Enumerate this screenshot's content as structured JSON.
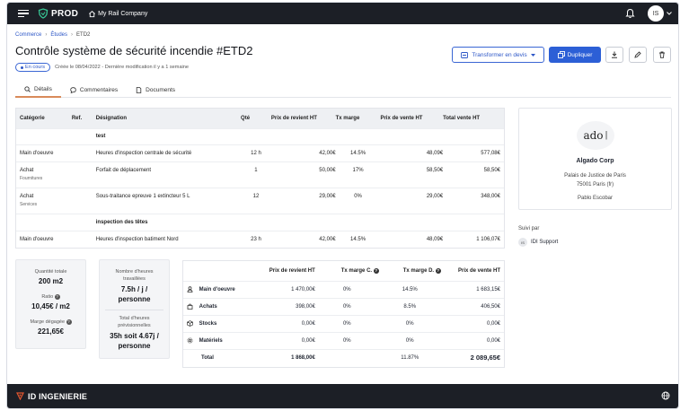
{
  "app": {
    "env": "PROD",
    "company": "My Rail Company",
    "avatar_initials": "IS"
  },
  "breadcrumb": [
    "Commerce",
    "Études",
    "ETD2"
  ],
  "page": {
    "title": "Contrôle système de sécurité incendie #ETD2",
    "status": "En cours",
    "meta": "Créée le 08/04/2022 - Dernière modification il y a 1 semaine"
  },
  "actions": {
    "transform": "Transformer en devis",
    "duplicate": "Dupliquer"
  },
  "tabs": [
    "Détails",
    "Commentaires",
    "Documents"
  ],
  "table": {
    "headers": [
      "Catégorie",
      "Ref.",
      "Désignation",
      "Qté",
      "Prix de revient HT",
      "Tx marge",
      "Prix de vente HT",
      "Total vente HT"
    ],
    "rows": [
      {
        "section": "test"
      },
      {
        "cat": "Main d'oeuvre",
        "sub": "",
        "ref": "",
        "des": "Heures d'inspection centrale de sécurité",
        "qty": "12 h",
        "cost": "42,00€",
        "margin": "14.5%",
        "price": "48,09€",
        "total": "577,08€"
      },
      {
        "cat": "Achat",
        "sub": "Fournitures",
        "ref": "",
        "des": "Forfait de déplacement",
        "qty": "1",
        "cost": "50,00€",
        "margin": "17%",
        "price": "58,50€",
        "total": "58,50€"
      },
      {
        "cat": "Achat",
        "sub": "Services",
        "ref": "",
        "des": "Sous-traitance epreuve 1 extincteur 5 L",
        "qty": "12",
        "cost": "29,00€",
        "margin": "0%",
        "price": "29,00€",
        "total": "348,00€"
      },
      {
        "section": "inspection des têtes"
      },
      {
        "cat": "Main d'oeuvre",
        "sub": "",
        "ref": "",
        "des": "Heures d'inspection batiment Nord",
        "qty": "23 h",
        "cost": "42,00€",
        "margin": "14.5%",
        "price": "48,09€",
        "total": "1 106,07€"
      }
    ]
  },
  "client": {
    "logo_text": "ado",
    "name": "Algado Corp",
    "address1": "Palais de Justice de Paris",
    "address2": "75001 Paris (fr)",
    "contact": "Pablo Escobar"
  },
  "followed": {
    "label": "Suivi par",
    "initials": "IS",
    "name": "IDI Support"
  },
  "stats1": [
    {
      "label": "Quantité totale",
      "value": "200 m2"
    },
    {
      "label": "Ratio",
      "value": "10,45€ / m2"
    },
    {
      "label": "Marge dégagée",
      "value": "221,65€"
    }
  ],
  "stats2": [
    {
      "label1": "Nombre d'heures",
      "label2": "travaillées",
      "value1": "7.5h / j /",
      "value2": "personne"
    },
    {
      "label1": "Total d'heures",
      "label2": "prévisionnelles",
      "value1": "35h soit 4.67j /",
      "value2": "personne"
    }
  ],
  "summary": {
    "headers": [
      "Prix de revient HT",
      "Tx marge C.",
      "Tx marge D.",
      "Prix de vente HT"
    ],
    "rows": [
      {
        "label": "Main d'oeuvre",
        "icon": "person-icon",
        "cost": "1 470,00€",
        "mc": "0%",
        "md": "14.5%",
        "price": "1 683,15€"
      },
      {
        "label": "Achats",
        "icon": "bag-icon",
        "cost": "398,00€",
        "mc": "0%",
        "md": "8.5%",
        "price": "406,50€"
      },
      {
        "label": "Stocks",
        "icon": "box-icon",
        "cost": "0,00€",
        "mc": "0%",
        "md": "0%",
        "price": "0,00€"
      },
      {
        "label": "Matériels",
        "icon": "gear-icon",
        "cost": "0,00€",
        "mc": "0%",
        "md": "0%",
        "price": "0,00€"
      }
    ],
    "total": {
      "label": "Total",
      "cost": "1 868,00€",
      "mc": "",
      "md": "11.87%",
      "price": "2 089,65€"
    }
  },
  "footer": {
    "brand": "ID INGENIERIE"
  }
}
